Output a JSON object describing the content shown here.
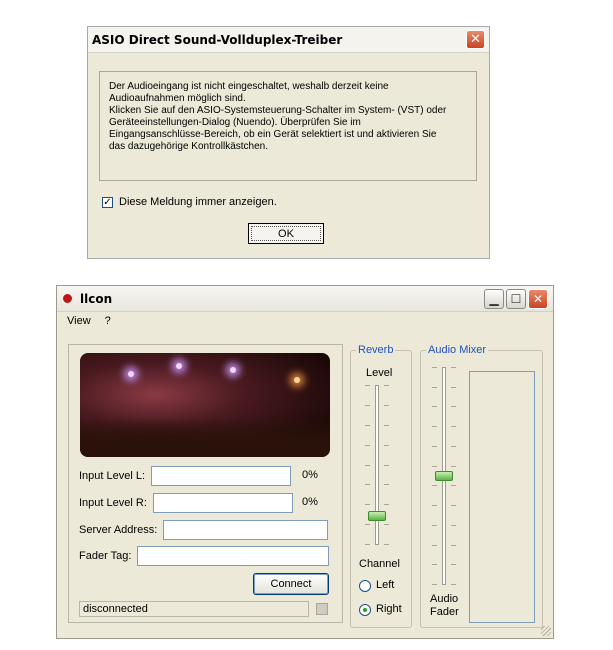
{
  "dialog_asio": {
    "title": "ASIO Direct Sound-Vollduplex-Treiber",
    "close_glyph": "✕",
    "message_lines": [
      "Der Audioeingang ist nicht eingeschaltet, weshalb derzeit keine",
      "Audioaufnahmen möglich sind.",
      "Klicken Sie auf den ASIO-Systemsteuerung-Schalter im System- (VST) oder",
      "Geräteeinstellungen-Dialog (Nuendo).  Überprüfen Sie im",
      "Eingangsanschlüsse-Bereich, ob ein Gerät selektiert ist und aktivieren Sie",
      "das dazugehörige Kontrollkästchen."
    ],
    "checkbox_label": "Diese Meldung immer anzeigen.",
    "checkbox_checked": true,
    "ok_label": "OK"
  },
  "llcon": {
    "title": "llcon",
    "titlebar_icons": [
      "minimize-icon",
      "maximize-icon",
      "close-icon"
    ],
    "menu": [
      "View",
      "?"
    ],
    "input_level_l_label": "Input Level L:",
    "input_level_l_value": "0%",
    "input_level_r_label": "Input Level R:",
    "input_level_r_value": "0%",
    "server_address_label": "Server Address:",
    "server_address_value": "",
    "fader_tag_label": "Fader Tag:",
    "fader_tag_value": "",
    "connect_label": "Connect",
    "status_text": "disconnected",
    "reverb": {
      "legend": "Reverb",
      "level_label": "Level",
      "level_fraction": 0.16,
      "channel_label": "Channel",
      "options": [
        "Left",
        "Right"
      ],
      "selected": "Right"
    },
    "mixer": {
      "legend": "Audio Mixer",
      "fader_label_line1": "Audio",
      "fader_label_line2": "Fader",
      "fader_fraction": 0.5
    },
    "colors": {
      "legend_blue": "#2152b8",
      "close_red": "#c94422",
      "thumb_green": "#5fb348"
    }
  }
}
